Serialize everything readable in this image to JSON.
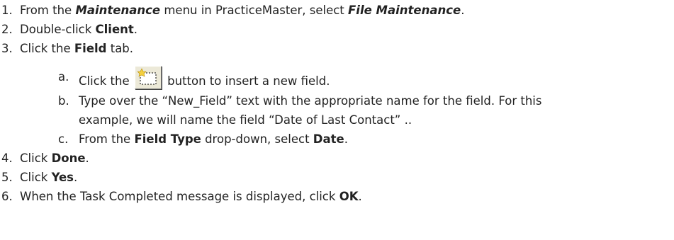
{
  "steps": [
    {
      "num": "1.",
      "parts": [
        {
          "t": "From the ",
          "s": ""
        },
        {
          "t": "Maintenance",
          "s": "bi"
        },
        {
          "t": " menu in PracticeMaster, select ",
          "s": ""
        },
        {
          "t": "File Maintenance",
          "s": "bi"
        },
        {
          "t": ".",
          "s": ""
        }
      ]
    },
    {
      "num": "2.",
      "parts": [
        {
          "t": "Double-click ",
          "s": ""
        },
        {
          "t": "Client",
          "s": "b"
        },
        {
          "t": ".",
          "s": ""
        }
      ]
    },
    {
      "num": "3.",
      "parts": [
        {
          "t": "Click the ",
          "s": ""
        },
        {
          "t": "Field",
          "s": "b"
        },
        {
          "t": " tab.",
          "s": ""
        }
      ]
    },
    {
      "num": "4.",
      "parts": [
        {
          "t": "Click ",
          "s": ""
        },
        {
          "t": "Done",
          "s": "b"
        },
        {
          "t": ".",
          "s": ""
        }
      ]
    },
    {
      "num": "5.",
      "parts": [
        {
          "t": "Click ",
          "s": ""
        },
        {
          "t": "Yes",
          "s": "b"
        },
        {
          "t": ".",
          "s": ""
        }
      ]
    },
    {
      "num": "6.",
      "parts": [
        {
          "t": "When the Task Completed message is displayed, click ",
          "s": ""
        },
        {
          "t": "OK",
          "s": "b"
        },
        {
          "t": ".",
          "s": ""
        }
      ]
    }
  ],
  "substeps": {
    "a": {
      "letter": "a.",
      "before": "Click the ",
      "icon": "insert-field-icon",
      "after": " button to insert a new field."
    },
    "b": {
      "letter": "b.",
      "line1": "Type over the “New_Field” text with the appropriate name for the field. For this",
      "line2": "example, we will name the field “Date of Last Contact” .."
    },
    "c": {
      "letter": "c.",
      "parts": [
        {
          "t": "From the ",
          "s": ""
        },
        {
          "t": "Field Type",
          "s": "b"
        },
        {
          "t": " drop-down, select ",
          "s": ""
        },
        {
          "t": "Date",
          "s": "b"
        },
        {
          "t": ".",
          "s": ""
        }
      ]
    }
  }
}
